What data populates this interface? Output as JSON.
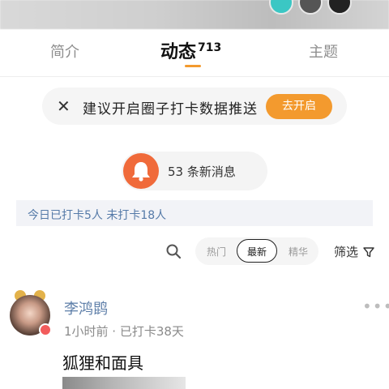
{
  "tabs": {
    "intro": "简介",
    "feed": "动态",
    "feed_count": "713",
    "topics": "主题"
  },
  "banner": {
    "close_glyph": "✕",
    "text": "建议开启圈子打卡数据推送",
    "button": "去开启"
  },
  "messages": {
    "text": "53 条新消息"
  },
  "checkin": {
    "text": "今日已打卡5人  未打卡18人"
  },
  "filter": {
    "options": [
      "热门",
      "最新",
      "精华"
    ],
    "selected": "最新",
    "label": "筛选"
  },
  "post": {
    "username": "李鸿鹍",
    "meta": "1小时前 · 已打卡38天",
    "more_glyph": "•••",
    "title": "狐狸和面具"
  },
  "colors": {
    "accent": "#f39a2e",
    "bell": "#f06a3a",
    "link": "#5d7ea8"
  }
}
